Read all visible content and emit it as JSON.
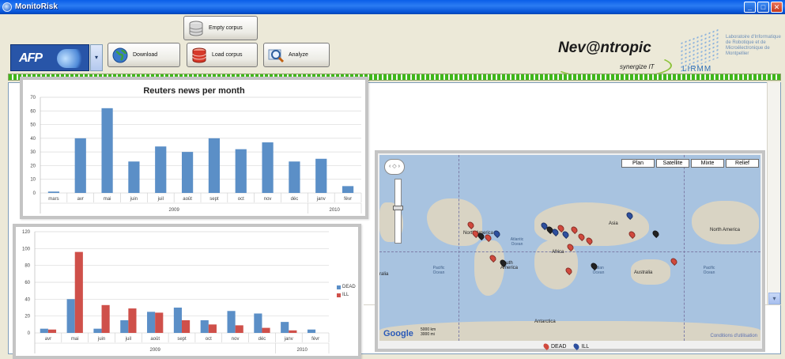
{
  "window": {
    "title": "MonitoRisk"
  },
  "toolbar": {
    "source_select": {
      "selected": "AFP"
    },
    "buttons": {
      "empty_corpus": "Empty corpus",
      "download": "Download",
      "load_corpus": "Load corpus",
      "analyze": "Analyze"
    },
    "logos": {
      "nevantropic": "Nev@ntropic",
      "nevantropic_tagline": "synergize IT",
      "lirmm": "LIRMM",
      "lirmm_text": "Laboratoire d'Informatique de Robotique et de Microélectronique de Montpellier"
    }
  },
  "progress": {
    "value": 1.0
  },
  "colors": {
    "bar_blue": "#5b8fc7",
    "bar_red": "#cf504a",
    "progress_green": "#3fb71a"
  },
  "chart_data": [
    {
      "type": "bar",
      "title": "Reuters news per month",
      "categories": [
        "mars",
        "avr",
        "mai",
        "juin",
        "juil",
        "août",
        "sept",
        "oct",
        "nov",
        "déc",
        "janv",
        "févr"
      ],
      "year_groups": [
        {
          "label": "2009",
          "from": 0,
          "to": 9
        },
        {
          "label": "2010",
          "from": 10,
          "to": 11
        }
      ],
      "values": [
        1,
        40,
        62,
        23,
        34,
        30,
        40,
        32,
        37,
        23,
        25,
        5
      ],
      "ylim": [
        0,
        70
      ],
      "yticks": [
        0,
        10,
        20,
        30,
        40,
        50,
        60,
        70
      ],
      "grid": true
    },
    {
      "type": "bar",
      "title": "",
      "categories": [
        "avr",
        "mai",
        "juin",
        "juil",
        "août",
        "sept",
        "oct",
        "nov",
        "déc",
        "janv",
        "févr"
      ],
      "year_groups": [
        {
          "label": "2009",
          "from": 0,
          "to": 8
        },
        {
          "label": "2010",
          "from": 9,
          "to": 10
        }
      ],
      "series": [
        {
          "name": "DEAD",
          "values": [
            5,
            40,
            5,
            15,
            25,
            30,
            15,
            26,
            23,
            13,
            4
          ]
        },
        {
          "name": "ILL",
          "values": [
            4,
            96,
            33,
            29,
            24,
            15,
            10,
            9,
            6,
            3,
            0
          ]
        }
      ],
      "ylim": [
        0,
        120
      ],
      "yticks": [
        0,
        20,
        40,
        60,
        80,
        100,
        120
      ],
      "legend": "right",
      "grid": true
    }
  ],
  "map": {
    "map_types": [
      "Plan",
      "Satellite",
      "Mixte",
      "Relief"
    ],
    "active_type": "Plan",
    "regions": [
      "North America",
      "North America",
      "Atlantic Ocean",
      "Africa",
      "Asia",
      "South America",
      "Indian Ocean",
      "Australia",
      "Pacific Ocean",
      "Pacific Ocean",
      "Antarctica",
      "ralia"
    ],
    "scale": [
      "5000 km",
      "3000 mi"
    ],
    "attribution": "Google",
    "terms": "Conditions d'utilisation",
    "legend": [
      {
        "name": "DEAD"
      },
      {
        "name": "ILL"
      }
    ]
  }
}
